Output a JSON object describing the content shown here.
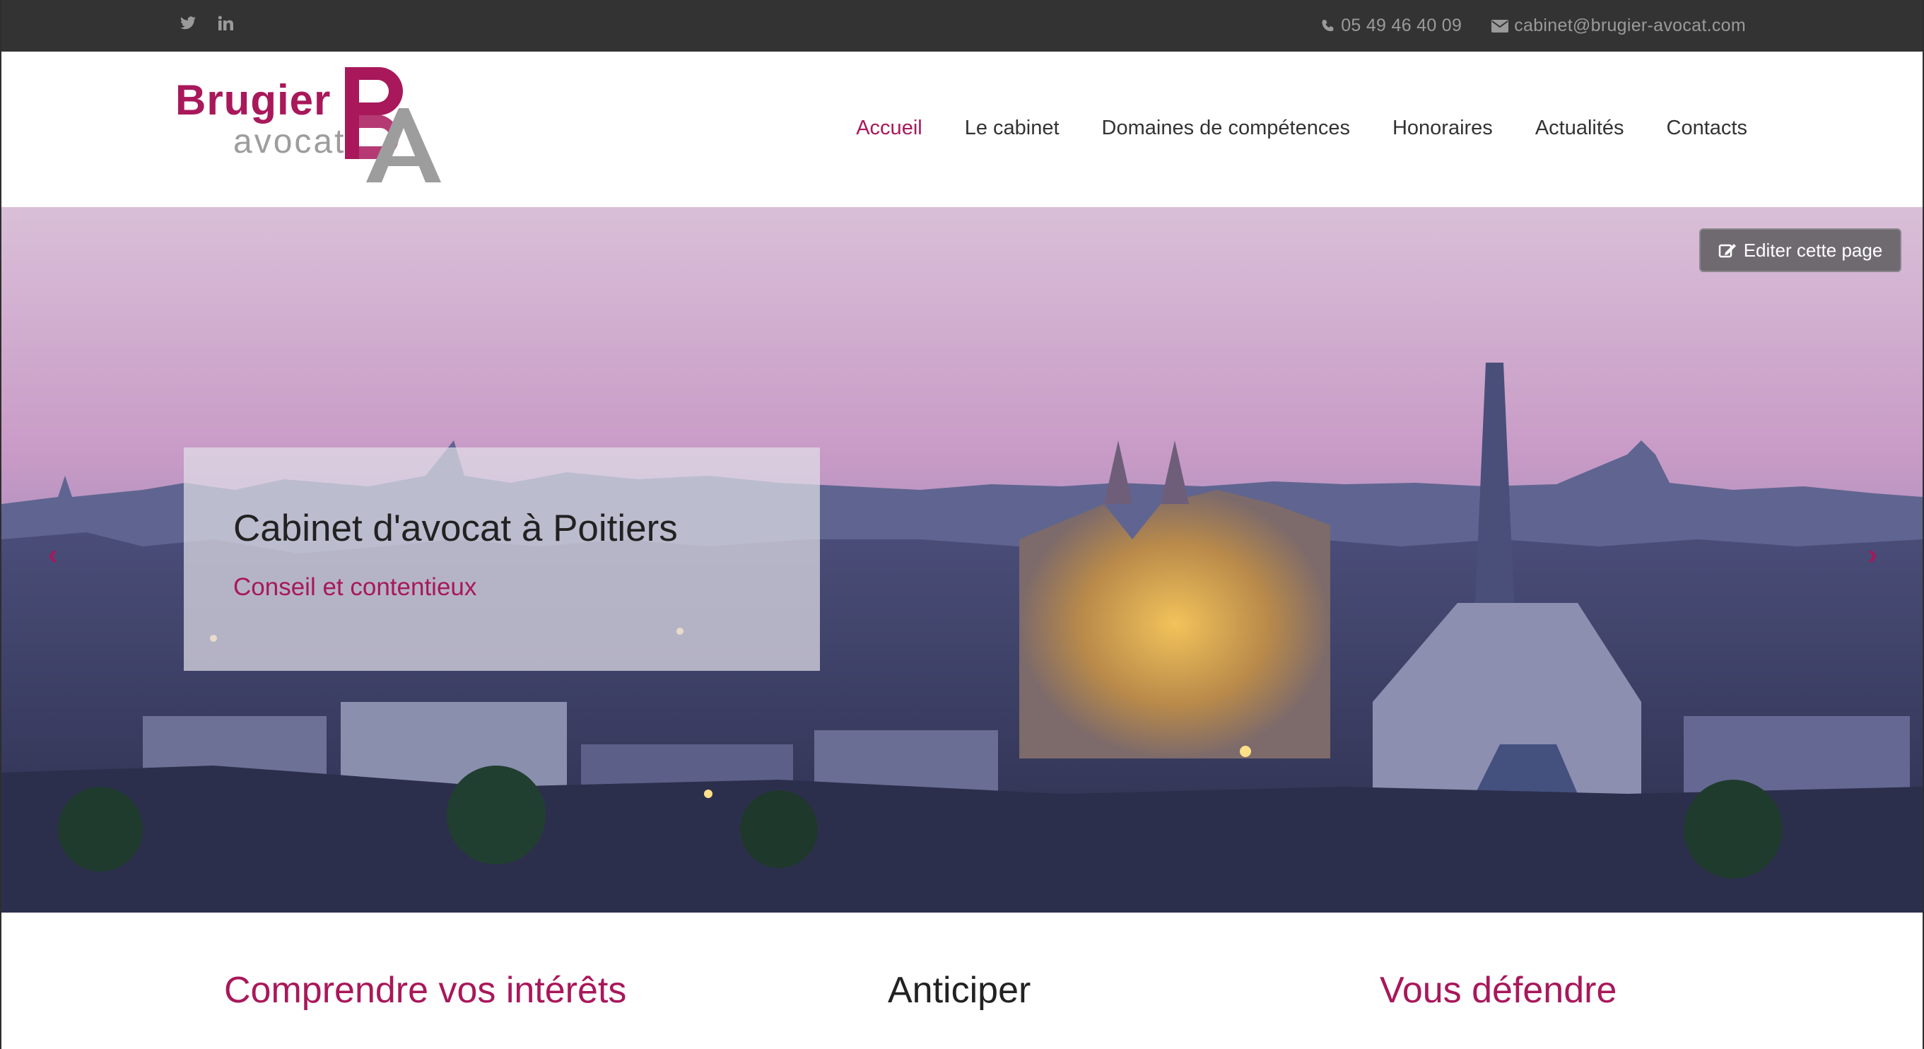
{
  "topbar": {
    "social": [
      {
        "icon": "twitter-icon"
      },
      {
        "icon": "linkedin-icon"
      }
    ],
    "phone": "05 49 46 40 09",
    "email": "cabinet@brugier-avocat.com"
  },
  "logo": {
    "brand": "Brugier",
    "sub": "avocat",
    "mark": "BA"
  },
  "nav": {
    "items": [
      {
        "label": "Accueil",
        "active": true
      },
      {
        "label": "Le cabinet"
      },
      {
        "label": "Domaines de compétences"
      },
      {
        "label": "Honoraires"
      },
      {
        "label": "Actualités"
      },
      {
        "label": "Contacts"
      }
    ]
  },
  "hero": {
    "title": "Cabinet d'avocat à Poitiers",
    "subtitle": "Conseil et contentieux",
    "edit_label": "Editer cette page",
    "prev_arrow": "‹",
    "next_arrow": "›"
  },
  "features": [
    "Comprendre vos intérêts",
    "Anticiper",
    "Vous défendre"
  ],
  "colors": {
    "accent": "#a8185a",
    "topbar": "#333333",
    "logo_grey": "#9d9d9d"
  }
}
